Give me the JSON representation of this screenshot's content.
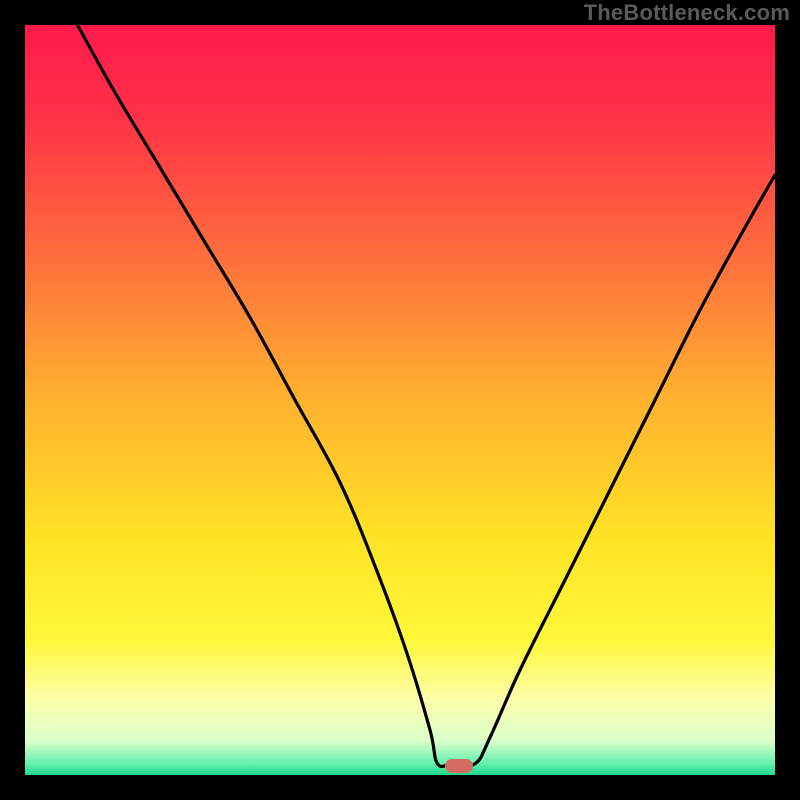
{
  "attribution": "TheBottleneck.com",
  "colors": {
    "bg_frame": "#000000",
    "curve": "#000000",
    "marker": "#d26b62",
    "gradient_stops": [
      {
        "offset": 0.0,
        "color": "#ff1a4a"
      },
      {
        "offset": 0.12,
        "color": "#ff3148"
      },
      {
        "offset": 0.3,
        "color": "#ff6b3d"
      },
      {
        "offset": 0.5,
        "color": "#ffb22f"
      },
      {
        "offset": 0.68,
        "color": "#ffe225"
      },
      {
        "offset": 0.82,
        "color": "#fff83a"
      },
      {
        "offset": 0.9,
        "color": "#fcffab"
      },
      {
        "offset": 0.955,
        "color": "#d9ffc9"
      },
      {
        "offset": 0.985,
        "color": "#63f0b0"
      },
      {
        "offset": 1.0,
        "color": "#1fd68a"
      }
    ]
  },
  "chart_data": {
    "type": "line",
    "title": "",
    "xlabel": "",
    "ylabel": "",
    "xlim": [
      0,
      100
    ],
    "ylim": [
      0,
      100
    ],
    "series": [
      {
        "name": "bottleneck-curve",
        "x": [
          7,
          12,
          18,
          24,
          30,
          36,
          42,
          47,
          51,
          54,
          55,
          57,
          60,
          62,
          66,
          72,
          78,
          84,
          90,
          96,
          100
        ],
        "y": [
          100,
          91,
          81,
          71,
          61,
          50,
          39,
          27,
          16,
          6,
          1.5,
          1.5,
          1.5,
          5,
          14,
          26,
          38,
          50,
          62,
          73,
          80
        ]
      }
    ],
    "marker": {
      "x": 57.8,
      "y": 1.2
    }
  }
}
